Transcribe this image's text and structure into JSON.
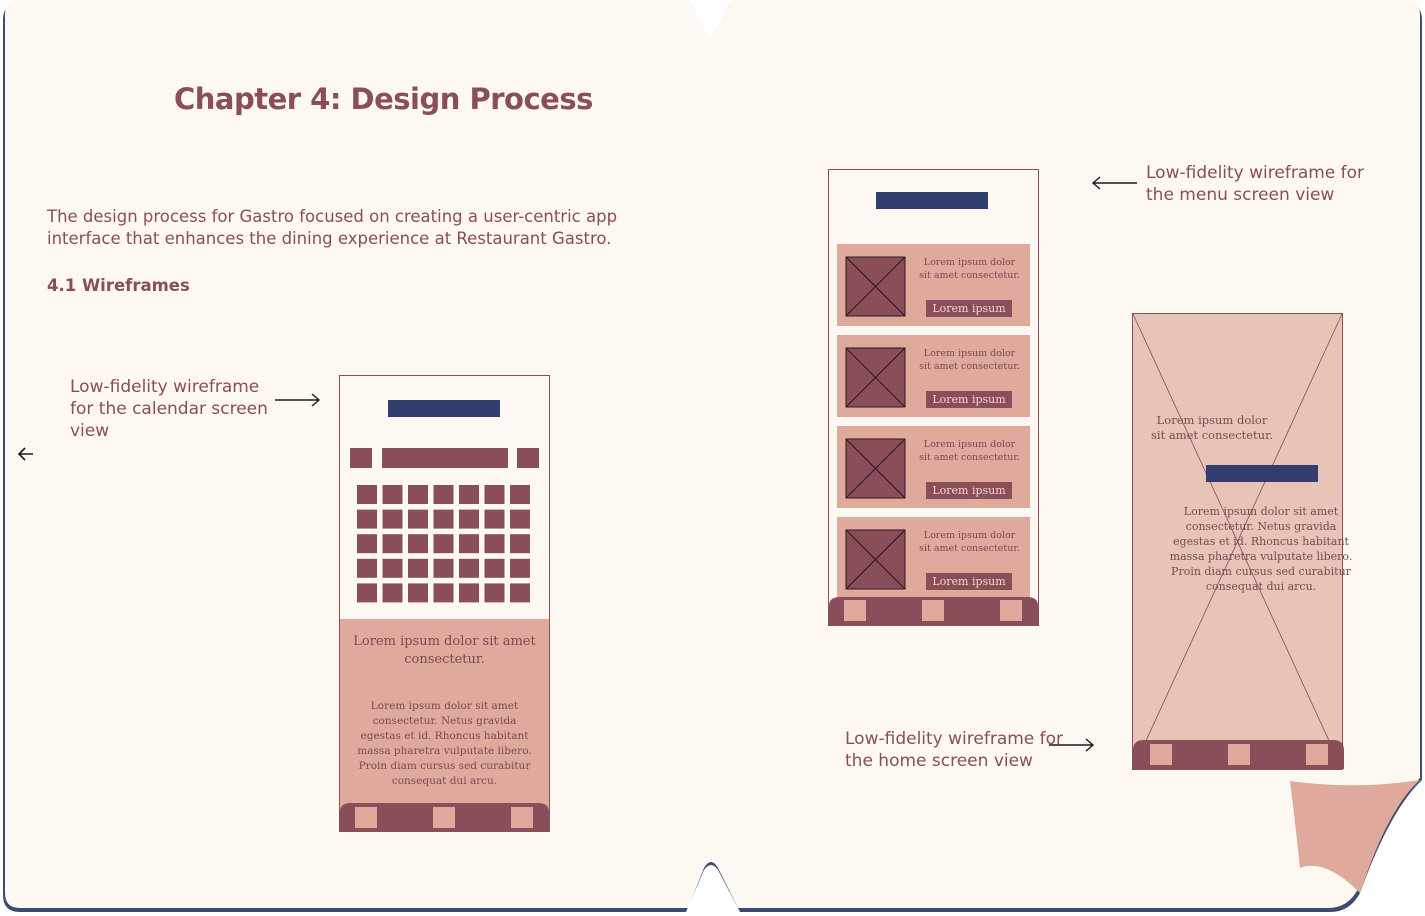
{
  "document": {
    "title": "Chapter 4: Design Process",
    "intro": "The design process for Gastro focused on creating a user-centric app interface that enhances the dining experience at Restaurant Gastro.",
    "section_heading": "4.1 Wireframes"
  },
  "captions": {
    "calendar": "Low-fidelity wireframe for the calendar screen view",
    "menu": "Low-fidelity wireframe for the menu screen view",
    "home": "Low-fidelity wireframe for the home screen view"
  },
  "calendar_wireframe": {
    "heading": "Lorem ipsum dolor sit amet consectetur.",
    "body": "Lorem ipsum dolor sit amet consectetur. Netus gravida egestas et id. Rhoncus habitant massa pharetra vulputate libero. Proin diam cursus sed curabitur consequat dui arcu."
  },
  "menu_wireframe": {
    "items": [
      {
        "text": "Lorem ipsum dolor sit amet consectetur.",
        "button": "Lorem ipsum"
      },
      {
        "text": "Lorem ipsum dolor sit amet consectetur.",
        "button": "Lorem ipsum"
      },
      {
        "text": "Lorem ipsum dolor sit amet consectetur.",
        "button": "Lorem ipsum"
      },
      {
        "text": "Lorem ipsum dolor sit amet consectetur.",
        "button": "Lorem ipsum"
      }
    ]
  },
  "home_wireframe": {
    "heading": "Lorem ipsum dolor sit amet consectetur.",
    "body": "Lorem ipsum dolor sit amet consectetur. Netus gravida egestas et id. Rhoncus habitant massa pharetra vulputate libero. Proin diam cursus sed curabitur consequat dui arcu."
  },
  "colors": {
    "page": "#fdf9f2",
    "brand": "#8a4d5a",
    "navy": "#323c6e",
    "rose": "#dfaa9c",
    "rose_light": "#e8c3b8",
    "page_edge": "#3d4a72"
  },
  "icons": {
    "back": "arrow-left-icon",
    "pointer": "arrow-right-icon",
    "image_placeholder": "image-placeholder-icon"
  }
}
